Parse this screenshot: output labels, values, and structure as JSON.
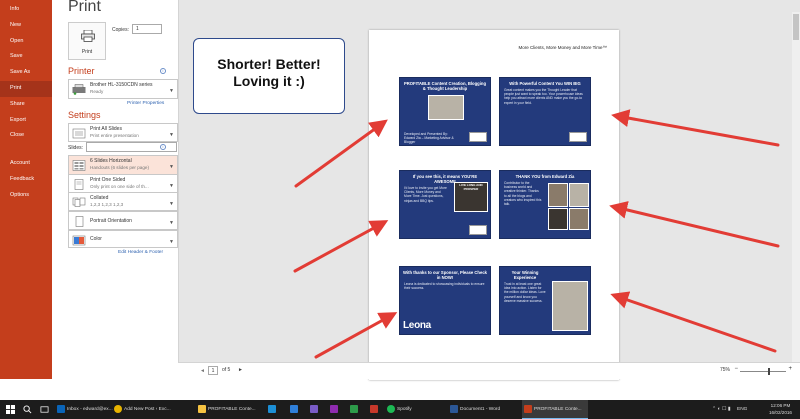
{
  "rail": {
    "items": [
      {
        "label": "Info"
      },
      {
        "label": "New"
      },
      {
        "label": "Open"
      },
      {
        "label": "Save"
      },
      {
        "label": "Save As"
      },
      {
        "label": "Print"
      },
      {
        "label": "Share"
      },
      {
        "label": "Export"
      },
      {
        "label": "Close"
      }
    ],
    "lower": [
      {
        "label": "Account"
      },
      {
        "label": "Feedback"
      },
      {
        "label": "Options"
      }
    ],
    "active": "Print",
    "color": "#c43e1c"
  },
  "settings": {
    "title": "Print",
    "print_button": "Print",
    "copies_label": "Copies:",
    "copies_value": "1",
    "printer_heading": "Printer",
    "printer_name": "Brother HL-3150CDN series",
    "printer_status": "Ready",
    "printer_properties": "Printer Properties",
    "settings_heading": "Settings",
    "range": {
      "l1": "Print All Slides",
      "l2": "Print entire presentation"
    },
    "slides_label": "Slides:",
    "layout": {
      "l1": "6 Slides Horizontal",
      "l2": "Handouts (6 slides per page)"
    },
    "sides": {
      "l1": "Print One Sided",
      "l2": "Only print on one side of th..."
    },
    "collate": {
      "l1": "Collated",
      "l2": "1,2,3   1,2,3   1,2,3"
    },
    "orientation": {
      "l1": "Portrait Orientation"
    },
    "color": {
      "l1": "Color"
    },
    "edit_header": "Edit Header & Footer"
  },
  "callout": {
    "line1": "Shorter! Better!",
    "line2": "Loving it :)"
  },
  "page": {
    "header": "More Clients, More Money and More Time™",
    "number": "1",
    "slides": [
      {
        "title": "PROFITABLE Content Creation, Blogging & Thought Leadership",
        "body": "Developed and Presented By: Edward Zia – Marketing Advisor & Blogger"
      },
      {
        "title": "With Powerful Content You WIN BIG",
        "body": "Great content makes you the Thought Leader that people just want to speak too. Your powerhouse ideas help you attract more clients AND make you the go-to expert in your field."
      },
      {
        "title": "If you see this, it means YOU'RE AWESOME",
        "body": "I'd love to invite you get More Clients, More Money and More Time. Just questions, ninjas and BBQ tips.",
        "badge": "LIVE LONG AND PROSPER"
      },
      {
        "title": "THANK YOU from Edward Zia",
        "body": "Contributor to the business world and creative thinker. Thanks to all the blogs and creators who inspired this talk."
      },
      {
        "title": "With thanks to our Sponsor, Please Check in NOW!",
        "body": "Leona is dedicated to showcasing individuals to ensure their success.",
        "logo": "Leona"
      },
      {
        "title": "Your Winning Experience",
        "body": "Trust in at least one great idea into action. Listen for the million dollar ideas. Love yourself and know you deserve massive success."
      }
    ]
  },
  "pagenav": {
    "prev": "◄",
    "current": "1",
    "of": "of 5",
    "next": "►",
    "zoom": "75%",
    "zminus": "−",
    "zplus": "+"
  },
  "taskbar": {
    "items": [
      {
        "label": "Inbox - edward@ex..."
      },
      {
        "label": "Add New Post ‹ Exc..."
      },
      {
        "label": "PROFITABLE Conte..."
      },
      {
        "label": "Spotify"
      },
      {
        "label": "Document1 - Word"
      },
      {
        "label": "PROFITABLE Conte..."
      }
    ],
    "lang": "ENG",
    "time": "12:06 PM",
    "date": "16/02/2016"
  },
  "icons": [
    "windows-logo-icon",
    "search-icon",
    "task-view-icon",
    "printer-icon",
    "info-icon",
    "arrow-icon"
  ]
}
